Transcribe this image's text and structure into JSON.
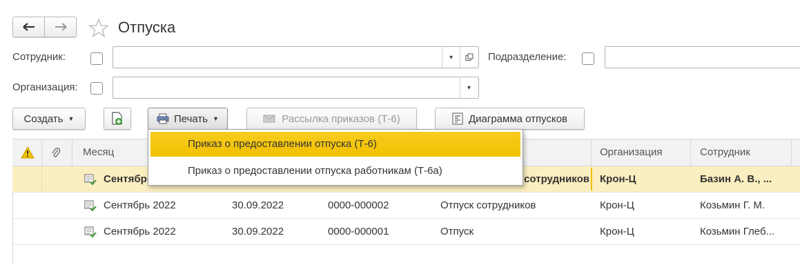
{
  "header": {
    "title": "Отпуска",
    "back_icon": "arrow-left-icon",
    "forward_icon": "arrow-right-icon",
    "star_icon": "star-icon"
  },
  "filters": {
    "employee_label": "Сотрудник:",
    "department_label": "Подразделение:",
    "organization_label": "Организация:",
    "employee_value": "",
    "department_value": "",
    "organization_value": ""
  },
  "toolbar": {
    "create_label": "Создать",
    "print_label": "Печать",
    "mailing_label": "Рассылка приказов (Т-6)",
    "diagram_label": "Диаграмма отпусков"
  },
  "print_menu": {
    "items": [
      {
        "label": "Приказ о предоставлении отпуска (Т-6)"
      },
      {
        "label": "Приказ о предоставлении отпуска работникам (Т-6а)"
      }
    ]
  },
  "table": {
    "columns": [
      "",
      "",
      "Месяц",
      "",
      "",
      "",
      "Организация",
      "Сотрудник"
    ],
    "rows": [
      {
        "month": "Сентябрь 2022",
        "date": "",
        "number": "",
        "type": "Отпуск сотрудников",
        "org": "Крон-Ц",
        "employee": "Базин А. В., ...",
        "selected": true
      },
      {
        "month": "Сентябрь 2022",
        "date": "30.09.2022",
        "number": "0000-000002",
        "type": "Отпуск сотрудников",
        "org": "Крон-Ц",
        "employee": "Козьмин Г. М.",
        "selected": false
      },
      {
        "month": "Сентябрь 2022",
        "date": "30.09.2022",
        "number": "0000-000001",
        "type": "Отпуск",
        "org": "Крон-Ц",
        "employee": "Козьмин Глеб...",
        "selected": false
      }
    ]
  },
  "colors": {
    "selected_row": "#fbeec0",
    "menu_highlight": "#f5c400",
    "warning": "#f0c000",
    "doc_icon": "#3f9a3a"
  }
}
